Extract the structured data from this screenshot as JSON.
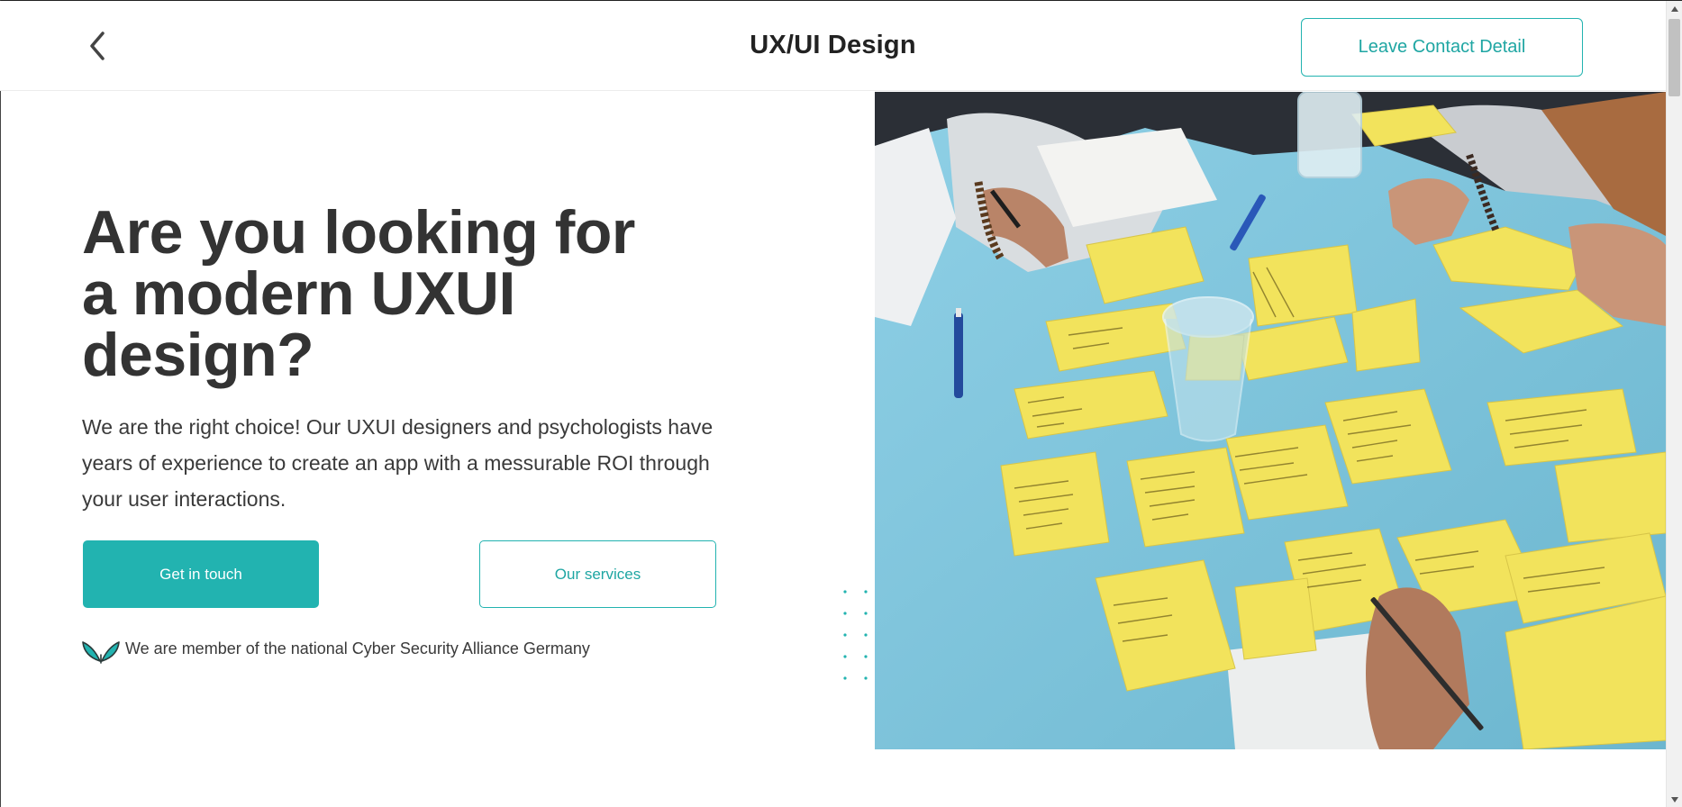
{
  "header": {
    "title": "UX/UI Design",
    "contact_label": "Leave Contact Detail"
  },
  "hero": {
    "headline_lines": [
      "Are you looking for",
      "a modern UXUI",
      "design?"
    ],
    "lead_lines": [
      "We are the right choice! Our UXUI designers and psychologists have",
      "years of experience to create an app with a messurable ROI through",
      "your user interactions."
    ],
    "primary_button": "Get in touch",
    "secondary_button": "Our services",
    "member_text": "We are member of the national Cyber Security Alliance Germany"
  },
  "colors": {
    "accent": "#22b3b0",
    "text": "#333333",
    "photo_table": "#7fc3d8",
    "sticky_note": "#f2e35c"
  },
  "icons": {
    "back": "chevron-left-icon",
    "member": "leaf-icon",
    "scroll_up": "triangle-up-icon",
    "scroll_down": "triangle-down-icon"
  }
}
